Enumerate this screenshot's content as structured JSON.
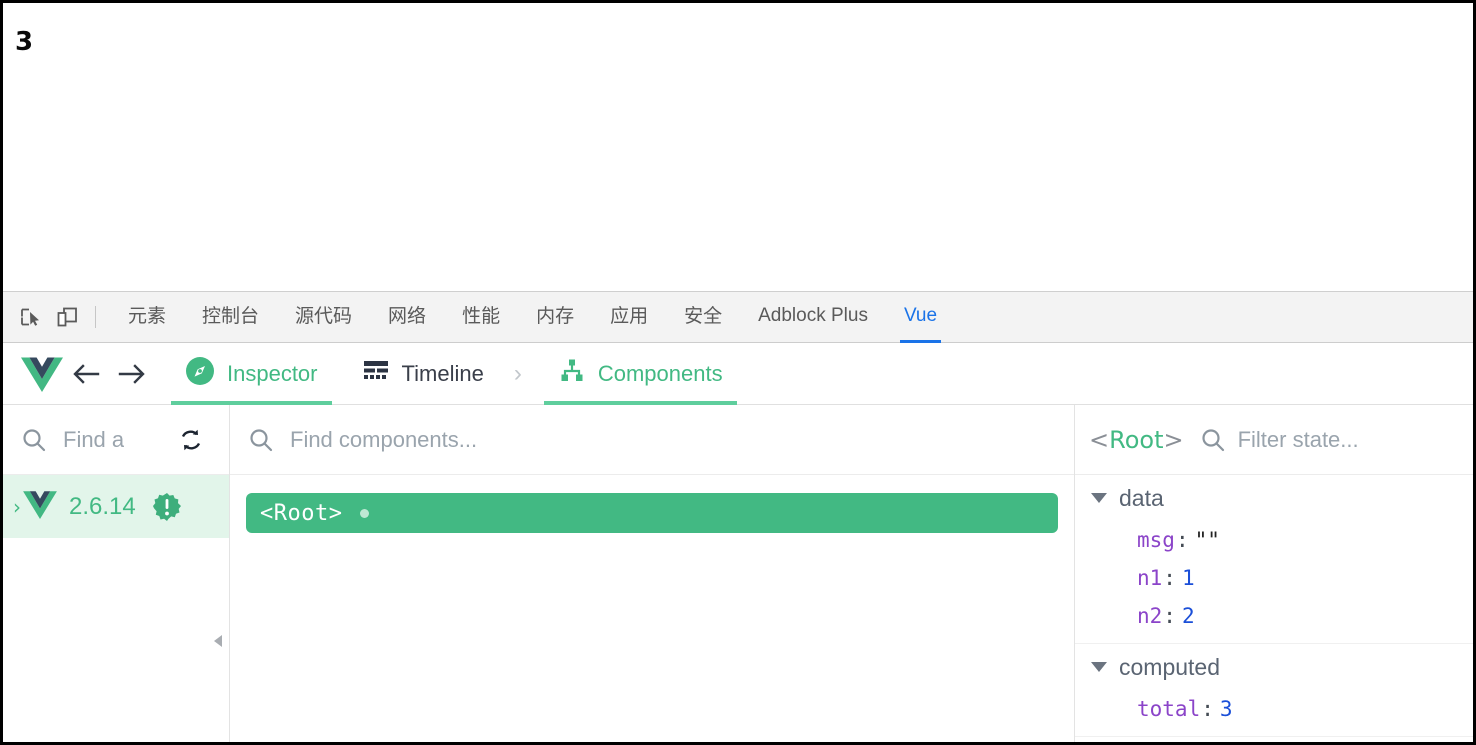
{
  "page": {
    "rendered_value": "3"
  },
  "devtools": {
    "icons": {
      "inspect": "inspect-element-icon",
      "device": "device-toolbar-icon"
    },
    "tabs": [
      {
        "label": "元素",
        "cjk": true,
        "active": false
      },
      {
        "label": "控制台",
        "cjk": true,
        "active": false
      },
      {
        "label": "源代码",
        "cjk": true,
        "active": false
      },
      {
        "label": "网络",
        "cjk": true,
        "active": false
      },
      {
        "label": "性能",
        "cjk": true,
        "active": false
      },
      {
        "label": "内存",
        "cjk": true,
        "active": false
      },
      {
        "label": "应用",
        "cjk": true,
        "active": false
      },
      {
        "label": "安全",
        "cjk": true,
        "active": false
      },
      {
        "label": "Adblock Plus",
        "cjk": false,
        "active": false
      },
      {
        "label": "Vue",
        "cjk": false,
        "active": true
      }
    ],
    "active_tab": "Vue",
    "accent_color": "#1a73e8"
  },
  "vue_toolbar": {
    "logo": "vue-logo",
    "back_icon": "arrow-left-icon",
    "forward_icon": "arrow-right-icon",
    "items": [
      {
        "label": "Inspector",
        "icon": "compass-icon",
        "active": true
      },
      {
        "label": "Timeline",
        "icon": "timeline-icon",
        "active": false
      }
    ],
    "separator": "›",
    "sub_item": {
      "label": "Components",
      "icon": "components-tree-icon",
      "active": true
    },
    "accent_color": "#42b983"
  },
  "apps_pane": {
    "search": {
      "placeholder": "Find a",
      "icon": "search-icon"
    },
    "refresh_icon": "refresh-icon",
    "app": {
      "chevron": "›",
      "logo": "vue-logo",
      "version": "2.6.14",
      "badge": "warning-badge",
      "selected": true
    },
    "collapse_icon": "collapse-left-icon"
  },
  "tree_pane": {
    "search": {
      "placeholder": "Find components...",
      "icon": "search-icon"
    },
    "components": [
      {
        "name": "<Root>",
        "selected": true,
        "has_dot": true
      }
    ]
  },
  "state_pane": {
    "title_open": "<",
    "title_name": "Root",
    "title_close": ">",
    "filter": {
      "placeholder": "Filter state...",
      "icon": "search-icon"
    },
    "groups": [
      {
        "name": "data",
        "expanded": true,
        "entries": [
          {
            "key": "msg",
            "value": "\"\"",
            "type": "string"
          },
          {
            "key": "n1",
            "value": "1",
            "type": "number"
          },
          {
            "key": "n2",
            "value": "2",
            "type": "number"
          }
        ]
      },
      {
        "name": "computed",
        "expanded": true,
        "entries": [
          {
            "key": "total",
            "value": "3",
            "type": "number"
          }
        ]
      }
    ]
  }
}
